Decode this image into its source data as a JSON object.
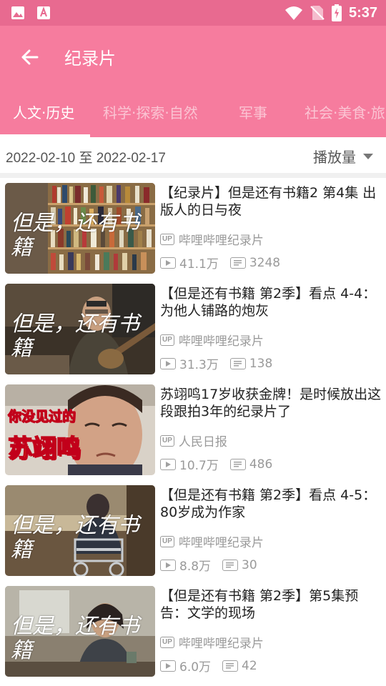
{
  "status": {
    "time": "5:37"
  },
  "appbar": {
    "title": "纪录片"
  },
  "tabs": [
    {
      "label": "人文·历史",
      "active": true
    },
    {
      "label": "科学·探索·自然",
      "active": false
    },
    {
      "label": "军事",
      "active": false
    },
    {
      "label": "社会·美食·旅",
      "active": false
    }
  ],
  "filter": {
    "date_range": "2022-02-10 至 2022-02-17",
    "sort_label": "播放量"
  },
  "videos": [
    {
      "title": "【纪录片】但是还有书籍2 第4集 出版人的日与夜",
      "uploader": "哔哩哔哩纪录片",
      "plays": "41.1万",
      "danmaku": "3248",
      "thumb_text": "但是，还有书籍"
    },
    {
      "title": "【但是还有书籍 第2季】看点 4-4：为他人铺路的炮灰",
      "uploader": "哔哩哔哩纪录片",
      "plays": "31.3万",
      "danmaku": "138",
      "thumb_text": "但是，还有书籍"
    },
    {
      "title": "苏翊鸣17岁收获金牌！是时候放出这段跟拍3年的纪录片了",
      "uploader": "人民日报",
      "plays": "10.7万",
      "danmaku": "486",
      "thumb_text_line1": "你没见过的",
      "thumb_text_line2": "苏翊鸣"
    },
    {
      "title": "【但是还有书籍 第2季】看点 4-5：80岁成为作家",
      "uploader": "哔哩哔哩纪录片",
      "plays": "8.8万",
      "danmaku": "30",
      "thumb_text": "但是，还有书籍"
    },
    {
      "title": "【但是还有书籍 第2季】第5集预告：文学的现场",
      "uploader": "哔哩哔哩纪录片",
      "plays": "6.0万",
      "danmaku": "42",
      "thumb_text": "但是，还有书籍"
    }
  ],
  "labels": {
    "up_badge": "UP"
  },
  "colors": {
    "accent": "#f67c9e",
    "status_bar": "#e86a90"
  }
}
